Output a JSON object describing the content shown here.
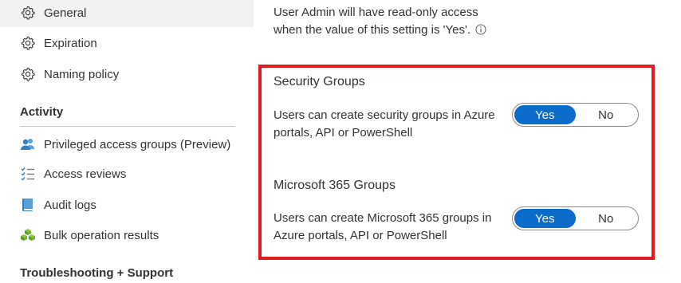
{
  "sidebar": {
    "items": [
      {
        "label": "General",
        "icon": "gear-icon",
        "selected": true
      },
      {
        "label": "Expiration",
        "icon": "gear-icon",
        "selected": false
      },
      {
        "label": "Naming policy",
        "icon": "gear-icon",
        "selected": false
      }
    ],
    "activity": {
      "heading": "Activity",
      "items": [
        {
          "label": "Privileged access groups (Preview)",
          "icon": "people-icon"
        },
        {
          "label": "Access reviews",
          "icon": "checklist-icon"
        },
        {
          "label": "Audit logs",
          "icon": "book-icon"
        },
        {
          "label": "Bulk operation results",
          "icon": "cubes-icon"
        }
      ]
    },
    "troubleshooting_heading": "Troubleshooting + Support"
  },
  "main": {
    "intro_line1": "User Admin will have read-only access",
    "intro_line2": "when the value of this setting is 'Yes'.",
    "security_groups": {
      "title": "Security Groups",
      "description": "Users can create security groups in Azure portals, API or PowerShell",
      "toggle": {
        "yes_label": "Yes",
        "no_label": "No",
        "value": "Yes"
      }
    },
    "m365_groups": {
      "title": "Microsoft 365 Groups",
      "description": "Users can create Microsoft 365 groups in Azure portals, API or PowerShell",
      "toggle": {
        "yes_label": "Yes",
        "no_label": "No",
        "value": "Yes"
      }
    }
  },
  "colors": {
    "accent": "#0b6bcb",
    "highlight_border": "#e01b22",
    "selected_background": "#f3f2f1"
  }
}
